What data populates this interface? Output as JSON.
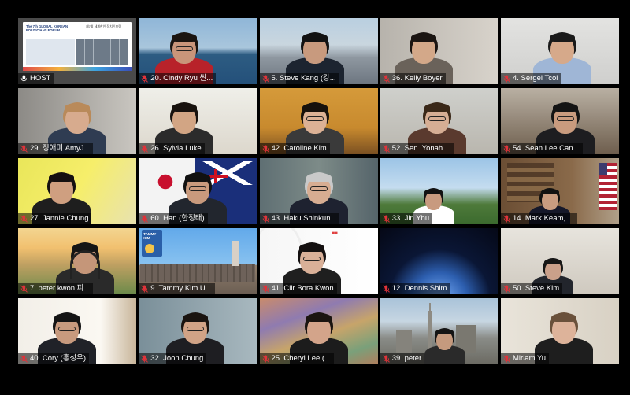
{
  "meeting": {
    "colors": {
      "active_border": "#d6e83a",
      "mic_muted": "#e0333a",
      "background": "#000000"
    },
    "tiles": [
      {
        "name": "HOST",
        "active": true,
        "muted": false,
        "presentation": {
          "title": "The 7th GLOBAL KOREAN POLITICIANS FORUM",
          "subtitle": "제7회 세계한인 정치인포럼"
        }
      },
      {
        "name": "20. Cindy Ryu 씬...",
        "muted": true
      },
      {
        "name": "5. Steve Kang (강...",
        "muted": true
      },
      {
        "name": "36. Kelly Boyer",
        "muted": true
      },
      {
        "name": "4. Sergei Tcoi",
        "muted": true
      },
      {
        "name": "29. 정애미 AmyJ...",
        "muted": true
      },
      {
        "name": "26. Sylvia Luke",
        "muted": true
      },
      {
        "name": "42. Caroline Kim",
        "muted": true
      },
      {
        "name": "52. Sen. Yonah ...",
        "muted": true
      },
      {
        "name": "54. Sean Lee Can...",
        "muted": true
      },
      {
        "name": "27. Jannie Chung",
        "muted": true
      },
      {
        "name": "60. Han (한정태)",
        "muted": true
      },
      {
        "name": "43. Haku Shinkun...",
        "muted": true
      },
      {
        "name": "33. Jin Yhu",
        "muted": true
      },
      {
        "name": "14. Mark Keam, ...",
        "muted": true
      },
      {
        "name": "7. peter kwon 피...",
        "muted": true
      },
      {
        "name": "9. Tammy Kim U...",
        "muted": true,
        "sign": "TAMMY KIM"
      },
      {
        "name": "41. Cllr Bora Kwon",
        "muted": true
      },
      {
        "name": "12. Dennis Shim",
        "muted": true
      },
      {
        "name": "50. Steve Kim",
        "muted": true
      },
      {
        "name": "40. Cory (홍성우)",
        "muted": true
      },
      {
        "name": "32. Joon Chung",
        "muted": true
      },
      {
        "name": "25. Cheryl Lee (...",
        "muted": true
      },
      {
        "name": "39. peter",
        "muted": true
      },
      {
        "name": "Miriam Yu",
        "muted": true
      }
    ]
  }
}
